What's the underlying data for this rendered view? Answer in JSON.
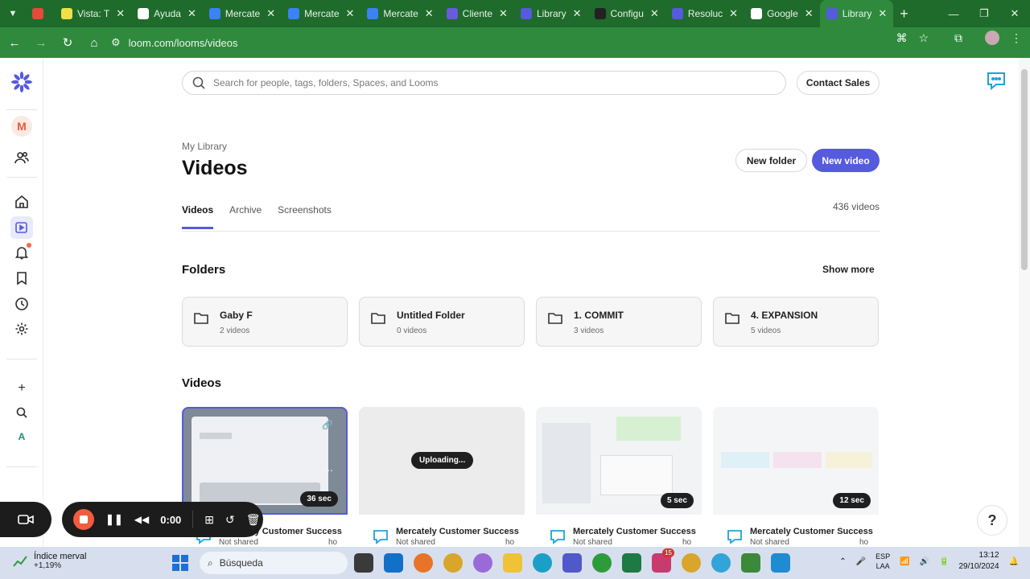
{
  "browser": {
    "tabs": [
      {
        "title": "",
        "icon": "record-dot-icon",
        "color": "#e34b3b"
      },
      {
        "title": "Vista: T",
        "icon": "vista-icon",
        "color": "#f0e048"
      },
      {
        "title": "Ayuda",
        "icon": "openai-icon",
        "color": "#ffffff"
      },
      {
        "title": "Mercate",
        "icon": "mercately-icon",
        "color": "#3b82f6"
      },
      {
        "title": "Mercate",
        "icon": "mercately-icon",
        "color": "#3b82f6"
      },
      {
        "title": "Mercate",
        "icon": "mercately-icon",
        "color": "#3b82f6"
      },
      {
        "title": "Cliente",
        "icon": "s-icon",
        "color": "#6a5ae0"
      },
      {
        "title": "Library",
        "icon": "loom-icon",
        "color": "#565add"
      },
      {
        "title": "Configu",
        "icon": "gear-icon",
        "color": "#222222"
      },
      {
        "title": "Resoluc",
        "icon": "loom-icon",
        "color": "#565add"
      },
      {
        "title": "Google",
        "icon": "google-icon",
        "color": "#ffffff"
      },
      {
        "title": "Library",
        "icon": "loom-icon",
        "color": "#565add",
        "active": true
      }
    ],
    "url": "loom.com/looms/videos"
  },
  "search": {
    "placeholder": "Search for people, tags, folders, Spaces, and Looms"
  },
  "header": {
    "contact_sales": "Contact Sales"
  },
  "page": {
    "breadcrumb": "My Library",
    "title": "Videos",
    "new_folder": "New folder",
    "new_video": "New video",
    "tabs": [
      "Videos",
      "Archive",
      "Screenshots"
    ],
    "video_count": "436 videos"
  },
  "folders_section": {
    "title": "Folders",
    "show_more": "Show more"
  },
  "folders": [
    {
      "name": "Gaby F",
      "count": "2 videos"
    },
    {
      "name": "Untitled Folder",
      "count": "0 videos"
    },
    {
      "name": "1. COMMIT",
      "count": "3 videos"
    },
    {
      "name": "4. EXPANSION",
      "count": "5 videos"
    }
  ],
  "videos_section": {
    "title": "Videos"
  },
  "videos": [
    {
      "duration": "36 sec",
      "title": "Mercately Customer Success",
      "share": "Not shared",
      "time": "ho"
    },
    {
      "status": "Uploading...",
      "title": "Mercately Customer Success",
      "share": "Not shared",
      "time": "ho"
    },
    {
      "duration": "5 sec",
      "title": "Mercately Customer Success",
      "share": "Not shared",
      "time": "ho"
    },
    {
      "duration": "12 sec",
      "title": "Mercately Customer Success",
      "share": "Not shared",
      "time": "ho"
    }
  ],
  "recorder": {
    "time": "0:00"
  },
  "taskbar": {
    "market_name": "Índice merval",
    "market_change": "+1,19%",
    "search_label": "Búsqueda",
    "lang_1": "ESP",
    "lang_2": "LAA",
    "time": "13:12",
    "date": "29/10/2024",
    "badge": "15"
  },
  "colors": {
    "accent": "#565add",
    "chrome": "#2f8a3e",
    "record": "#f35b3f"
  }
}
